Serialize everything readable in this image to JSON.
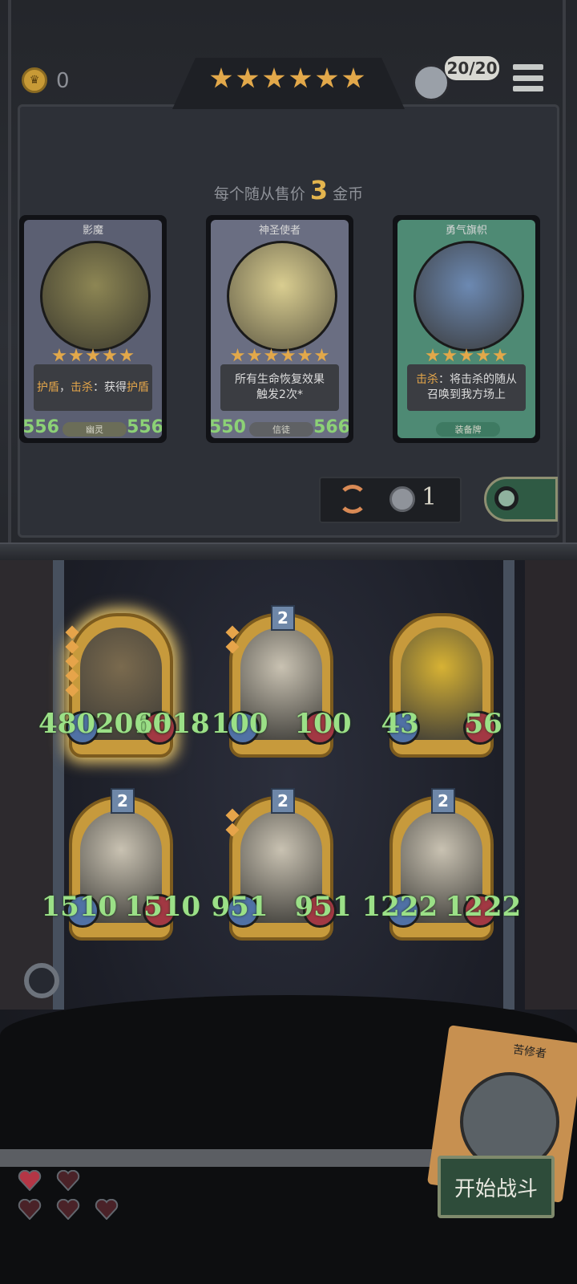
{
  "header": {
    "coins": "0",
    "shop_tier_stars": 6,
    "lives": "20/20"
  },
  "shop": {
    "price_prefix": "每个随从售价",
    "price_value": "3",
    "price_suffix": "金币",
    "cards": [
      {
        "name": "影魔",
        "desc_parts": [
          [
            "护盾",
            true
          ],
          [
            "，",
            false
          ],
          [
            "击杀",
            true
          ],
          [
            "：获得",
            false
          ],
          [
            "护盾",
            true
          ]
        ],
        "tag": "幽灵",
        "atk": "556",
        "hp": "556",
        "frame": "#5b5f72",
        "stars": 5
      },
      {
        "name": "神圣使者",
        "desc_line1": "所有生命恢复效果",
        "desc_line2": "触发2次*",
        "tag": "信徒",
        "atk": "550",
        "hp": "566",
        "frame": "#6a6e82",
        "stars": 6
      },
      {
        "name": "勇气旗帜",
        "desc_parts": [
          [
            "击杀",
            true
          ],
          [
            "：将击杀的随从",
            false
          ]
        ],
        "desc_line2": "召唤到我方场上",
        "tag": "装备牌",
        "frame": "#4e8a74",
        "stars": 5
      }
    ],
    "refresh_cost": "1"
  },
  "board": {
    "minions": [
      {
        "atk": "4802016",
        "hp": "6018",
        "level": "",
        "gems": 5,
        "portrait": "pumpkin"
      },
      {
        "atk": "100",
        "hp": "100",
        "level": "2",
        "gems": 2,
        "portrait": "elder"
      },
      {
        "atk": "43",
        "hp": "56",
        "level": "",
        "gems": 0,
        "portrait": "fire"
      },
      {
        "atk": "1510",
        "hp": "1510",
        "level": "2",
        "gems": 0,
        "portrait": "elder"
      },
      {
        "atk": "951",
        "hp": "951",
        "level": "2",
        "gems": 2,
        "portrait": "elder"
      },
      {
        "atk": "1222",
        "hp": "1222",
        "level": "2",
        "gems": 0,
        "portrait": "elder"
      }
    ]
  },
  "hero": {
    "name": "苦修者"
  },
  "actions": {
    "start_battle": "开始战斗"
  },
  "hearts": 5,
  "colors": {
    "gold": "#e2a84a",
    "stat_green": "#9be087",
    "heart": "#b43646"
  }
}
